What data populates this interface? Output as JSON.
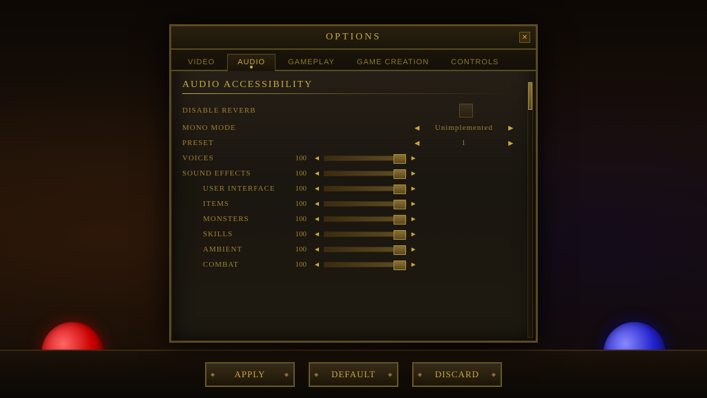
{
  "bg": {
    "color": "#1a1008"
  },
  "dialog": {
    "title": "Options",
    "close_label": "✕"
  },
  "tabs": [
    {
      "id": "video",
      "label": "Video",
      "active": false
    },
    {
      "id": "audio",
      "label": "Audio",
      "active": true
    },
    {
      "id": "gameplay",
      "label": "Gameplay",
      "active": false
    },
    {
      "id": "game_creation",
      "label": "Game Creation",
      "active": false
    },
    {
      "id": "controls",
      "label": "Controls",
      "active": false
    }
  ],
  "section": {
    "title": "Audio Accessibility"
  },
  "settings": [
    {
      "id": "disable_reverb",
      "label": "Disable Reverb",
      "type": "toggle",
      "value": false
    },
    {
      "id": "mono_mode",
      "label": "Mono Mode",
      "type": "arrow_select",
      "value": "Unimplemented"
    },
    {
      "id": "preset",
      "label": "Preset",
      "type": "arrow_select",
      "value": "1"
    },
    {
      "id": "voices",
      "label": "Voices",
      "type": "slider",
      "value": 100,
      "indented": false
    },
    {
      "id": "sound_effects",
      "label": "Sound Effects",
      "type": "slider",
      "value": 100,
      "indented": false
    },
    {
      "id": "user_interface",
      "label": "User Interface",
      "type": "slider",
      "value": 100,
      "indented": true
    },
    {
      "id": "items",
      "label": "Items",
      "type": "slider",
      "value": 100,
      "indented": true
    },
    {
      "id": "monsters",
      "label": "Monsters",
      "type": "slider",
      "value": 100,
      "indented": true
    },
    {
      "id": "skills",
      "label": "Skills",
      "type": "slider",
      "value": 100,
      "indented": true
    },
    {
      "id": "ambient",
      "label": "Ambient",
      "type": "slider",
      "value": 100,
      "indented": true
    },
    {
      "id": "combat",
      "label": "Combat",
      "type": "slider",
      "value": 100,
      "indented": true
    }
  ],
  "buttons": {
    "apply": "Apply",
    "default": "Default",
    "discard": "Discard"
  }
}
